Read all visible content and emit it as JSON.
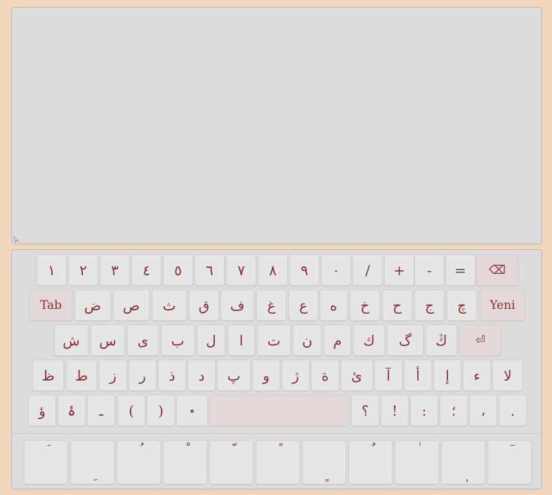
{
  "keyboard": {
    "row1": [
      "١",
      "٢",
      "٣",
      "٤",
      "٥",
      "٦",
      "٧",
      "٨",
      "٩",
      "٠",
      "/",
      "+",
      "-",
      "="
    ],
    "backspace_label": "⌫",
    "tab_label": "Tab",
    "row2": [
      "ض",
      "ص",
      "ث",
      "ق",
      "ف",
      "غ",
      "ع",
      "ه",
      "خ",
      "ح",
      "ج",
      "چ"
    ],
    "newline_label": "Yeni",
    "row3": [
      "ش",
      "س",
      "ى",
      "ب",
      "ل",
      "ا",
      "ت",
      "ن",
      "م",
      "ك",
      "گ",
      "ڭ"
    ],
    "enter_label": "⏎",
    "row4": [
      "ظ",
      "ط",
      "ز",
      "ر",
      "ذ",
      "د",
      "پ",
      "و",
      "ژ",
      "ة",
      "ئ",
      "آ",
      "أ",
      "إ",
      "ء",
      "لا"
    ],
    "row5_left": [
      "ؤ",
      "ۀ",
      "ـ",
      "(",
      ")",
      "٭"
    ],
    "space_label": "",
    "row5_right": [
      "؟",
      "!",
      ":",
      "؛",
      "،",
      "."
    ]
  },
  "diacritics": [
    {
      "top": "َ",
      "bottom": ""
    },
    {
      "top": "",
      "bottom": "ِ"
    },
    {
      "top": "ُ",
      "bottom": ""
    },
    {
      "top": "ْ",
      "bottom": ""
    },
    {
      "top": "ّ",
      "bottom": ""
    },
    {
      "top": "ً",
      "bottom": ""
    },
    {
      "top": "",
      "bottom": "ٍ"
    },
    {
      "top": "ٌ",
      "bottom": ""
    },
    {
      "top": "ٰ",
      "bottom": ""
    },
    {
      "top": "",
      "bottom": "ٖ"
    },
    {
      "top": "ٓ",
      "bottom": ""
    }
  ]
}
